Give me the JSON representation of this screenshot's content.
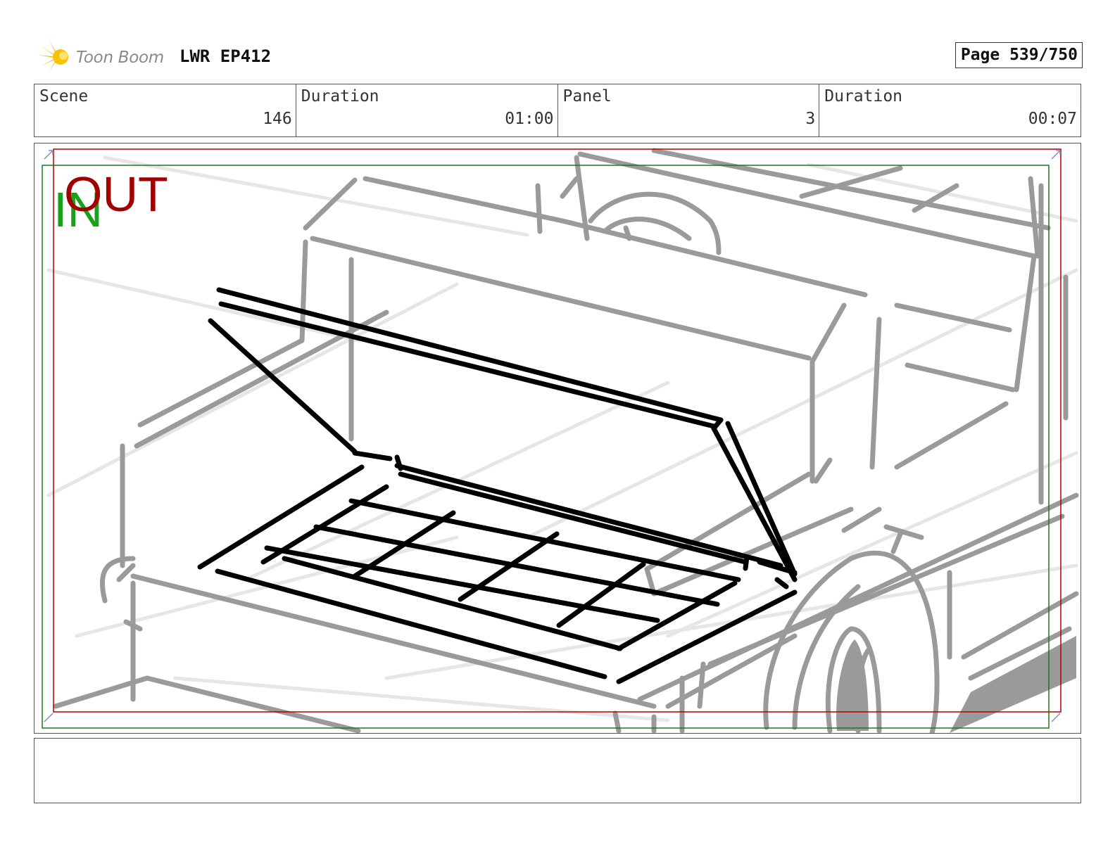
{
  "header": {
    "logo_text": "Toon Boom",
    "production": "LWR EP412",
    "page_label": "Page 539/750"
  },
  "info": {
    "scene_label": "Scene",
    "scene_value": "146",
    "scene_duration_label": "Duration",
    "scene_duration_value": "01:00",
    "panel_label": "Panel",
    "panel_value": "3",
    "panel_duration_label": "Duration",
    "panel_duration_value": "00:07"
  },
  "panel": {
    "in_mark": "IN",
    "out_mark": "OUT",
    "in_color": "#1aa01a",
    "out_color": "#a00000",
    "sketch_description_icon": "storyboard-sketch-truck-open-toolbox"
  },
  "caption": {
    "text": ""
  }
}
